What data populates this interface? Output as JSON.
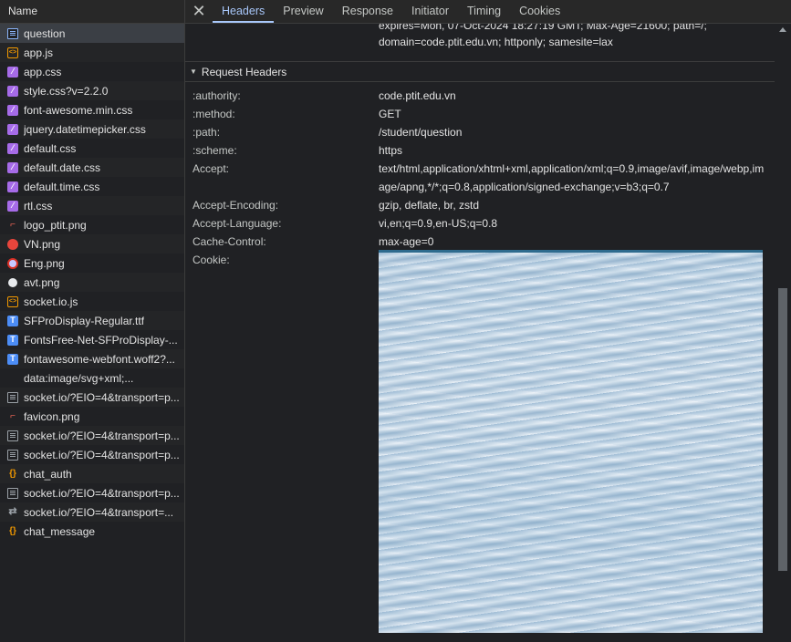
{
  "sidebar": {
    "header": "Name",
    "files": [
      {
        "name": "question",
        "icon": "document-icon"
      },
      {
        "name": "app.js",
        "icon": "script-icon"
      },
      {
        "name": "app.css",
        "icon": "stylesheet-icon"
      },
      {
        "name": "style.css?v=2.2.0",
        "icon": "stylesheet-icon"
      },
      {
        "name": "font-awesome.min.css",
        "icon": "stylesheet-icon"
      },
      {
        "name": "jquery.datetimepicker.css",
        "icon": "stylesheet-icon"
      },
      {
        "name": "default.css",
        "icon": "stylesheet-icon"
      },
      {
        "name": "default.date.css",
        "icon": "stylesheet-icon"
      },
      {
        "name": "default.time.css",
        "icon": "stylesheet-icon"
      },
      {
        "name": "rtl.css",
        "icon": "stylesheet-icon"
      },
      {
        "name": "logo_ptit.png",
        "icon": "image-icon"
      },
      {
        "name": "VN.png",
        "icon": "image-icon"
      },
      {
        "name": "Eng.png",
        "icon": "image-icon"
      },
      {
        "name": "avt.png",
        "icon": "image-icon"
      },
      {
        "name": "socket.io.js",
        "icon": "script-icon"
      },
      {
        "name": "SFProDisplay-Regular.ttf",
        "icon": "font-icon"
      },
      {
        "name": "FontsFree-Net-SFProDisplay-...",
        "icon": "font-icon"
      },
      {
        "name": "fontawesome-webfont.woff2?...",
        "icon": "font-icon"
      },
      {
        "name": "data:image/svg+xml;...",
        "icon": "image-icon"
      },
      {
        "name": "socket.io/?EIO=4&transport=p...",
        "icon": "document-icon"
      },
      {
        "name": "favicon.png",
        "icon": "image-icon"
      },
      {
        "name": "socket.io/?EIO=4&transport=p...",
        "icon": "document-icon"
      },
      {
        "name": "socket.io/?EIO=4&transport=p...",
        "icon": "document-icon"
      },
      {
        "name": "chat_auth",
        "icon": "fetch-icon"
      },
      {
        "name": "socket.io/?EIO=4&transport=p...",
        "icon": "document-icon"
      },
      {
        "name": "socket.io/?EIO=4&transport=...",
        "icon": "websocket-icon"
      },
      {
        "name": "chat_message",
        "icon": "fetch-icon"
      }
    ]
  },
  "tabs": {
    "headers": "Headers",
    "preview": "Preview",
    "response": "Response",
    "initiator": "Initiator",
    "timing": "Timing",
    "cookies": "Cookies"
  },
  "response_cookie_tail": {
    "line1": "expires=Mon, 07-Oct-2024 18:27:19 GMT; Max-Age=21600; path=/;",
    "line2": "domain=code.ptit.edu.vn; httponly; samesite=lax"
  },
  "request_headers": {
    "title": "Request Headers",
    "authority": {
      "name": ":authority:",
      "value": "code.ptit.edu.vn"
    },
    "method": {
      "name": ":method:",
      "value": "GET"
    },
    "path": {
      "name": ":path:",
      "value": "/student/question"
    },
    "scheme": {
      "name": ":scheme:",
      "value": "https"
    },
    "accept": {
      "name": "Accept:",
      "value": "text/html,application/xhtml+xml,application/xml;q=0.9,image/avif,image/webp,image/apng,*/*;q=0.8,application/signed-exchange;v=b3;q=0.7"
    },
    "accept_encoding": {
      "name": "Accept-Encoding:",
      "value": "gzip, deflate, br, zstd"
    },
    "accept_language": {
      "name": "Accept-Language:",
      "value": "vi,en;q=0.9,en-US;q=0.8"
    },
    "cache_control": {
      "name": "Cache-Control:",
      "value": "max-age=0"
    },
    "cookie": {
      "name": "Cookie:"
    }
  }
}
